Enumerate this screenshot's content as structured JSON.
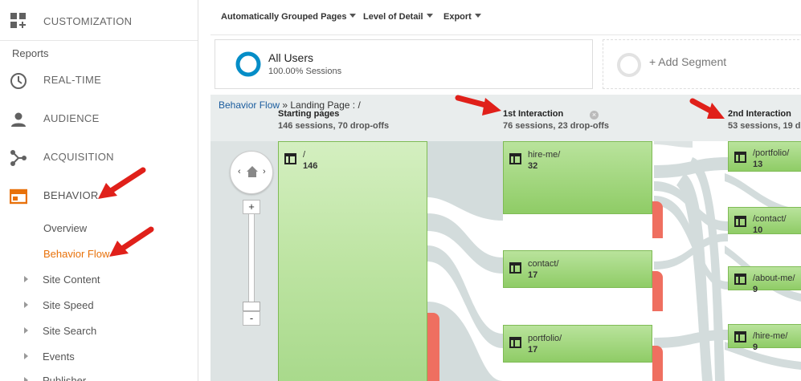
{
  "sidebar": {
    "customization_label": "CUSTOMIZATION",
    "reports_heading": "Reports",
    "nav": [
      {
        "label": "REAL-TIME"
      },
      {
        "label": "AUDIENCE"
      },
      {
        "label": "ACQUISITION"
      },
      {
        "label": "BEHAVIOR"
      }
    ],
    "behavior_sub": [
      {
        "label": "Overview"
      },
      {
        "label": "Behavior Flow"
      }
    ],
    "behavior_tree": [
      {
        "label": "Site Content"
      },
      {
        "label": "Site Speed"
      },
      {
        "label": "Site Search"
      },
      {
        "label": "Events"
      },
      {
        "label": "Publisher"
      }
    ]
  },
  "toolbar": {
    "grouping_label": "Automatically Grouped Pages",
    "detail_label": "Level of Detail",
    "export_label": "Export"
  },
  "segments": {
    "all_users_title": "All Users",
    "all_users_sub": "100.00% Sessions",
    "add_segment_label": "+ Add Segment"
  },
  "flow": {
    "breadcrumb_link": "Behavior Flow",
    "breadcrumb_rest": " » Landing Page : /",
    "columns": [
      {
        "title": "Starting pages",
        "sub": "146 sessions, 70 drop-offs"
      },
      {
        "title": "1st Interaction",
        "sub": "76 sessions, 23 drop-offs"
      },
      {
        "title": "2nd Interaction",
        "sub": "53 sessions, 19 d"
      }
    ],
    "start_node": {
      "name": "/",
      "count": "146"
    },
    "interaction1": [
      {
        "name": "hire-me/",
        "count": "32"
      },
      {
        "name": "contact/",
        "count": "17"
      },
      {
        "name": "portfolio/",
        "count": "17"
      }
    ],
    "interaction2": [
      {
        "name": "/portfolio/",
        "count": "13"
      },
      {
        "name": "/contact/",
        "count": "10"
      },
      {
        "name": "/about-me/",
        "count": "9"
      },
      {
        "name": "/hire-me/",
        "count": "9"
      }
    ],
    "zoom_plus": "+",
    "zoom_minus": "-",
    "zoom_left": "‹",
    "zoom_right": "›"
  },
  "colors": {
    "accent_orange": "#e8710a",
    "node_green": "#8fcc66",
    "dropoff_red": "#ef6f60",
    "annotation_red": "#e0201a",
    "link_blue": "#1a5c9e"
  }
}
